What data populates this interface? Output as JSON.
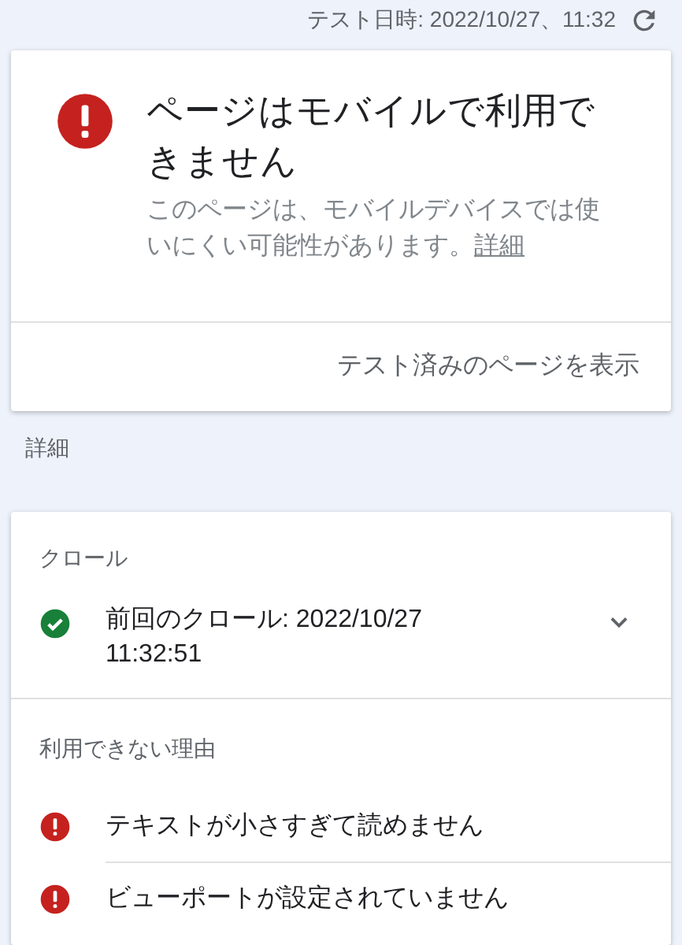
{
  "header": {
    "test_time": "テスト日時: 2022/10/27、11:32"
  },
  "result_card": {
    "title": "ページはモバイルで利用できません",
    "description": "このページは、モバイルデバイスでは使いにくい可能性があります。",
    "link": "詳細",
    "action": "テスト済みのページを表示"
  },
  "details_label": "詳細",
  "details_card": {
    "crawl": {
      "heading": "クロール",
      "item": {
        "kind": "ok",
        "text": "前回のクロール: 2022/10/27 11:32:51",
        "expanded": false
      }
    },
    "reasons": {
      "heading": "利用できない理由",
      "items": [
        {
          "kind": "error",
          "text": "テキストが小さすぎて読めません"
        },
        {
          "kind": "error",
          "text": "ビューポートが設定されていません"
        }
      ]
    }
  }
}
